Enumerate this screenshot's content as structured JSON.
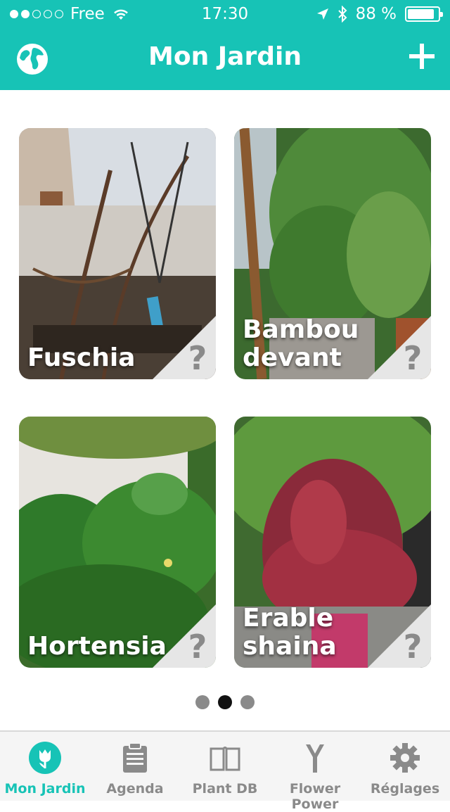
{
  "status_bar": {
    "carrier": "Free",
    "time": "17:30",
    "battery": "88 %",
    "battery_level": 0.88
  },
  "header": {
    "title": "Mon Jardin"
  },
  "plants": [
    {
      "name": "Fuschia",
      "badge": "?"
    },
    {
      "name": "Bambou devant",
      "badge": "?"
    },
    {
      "name": "Hortensia",
      "badge": "?"
    },
    {
      "name": "Erable shaina",
      "badge": "?"
    }
  ],
  "pager": {
    "pages": 3,
    "current": 2
  },
  "tabbar": {
    "items": [
      {
        "label": "Mon Jardin",
        "icon": "tulip-icon",
        "active": true
      },
      {
        "label": "Agenda",
        "icon": "clipboard-icon",
        "active": false
      },
      {
        "label": "Plant DB",
        "icon": "book-icon",
        "active": false
      },
      {
        "label": "Flower Power",
        "icon": "sensor-icon",
        "active": false
      },
      {
        "label": "Réglages",
        "icon": "gear-icon",
        "active": false
      }
    ]
  },
  "colors": {
    "accent": "#17c3b6",
    "tab_inactive": "#8a8a8a"
  }
}
